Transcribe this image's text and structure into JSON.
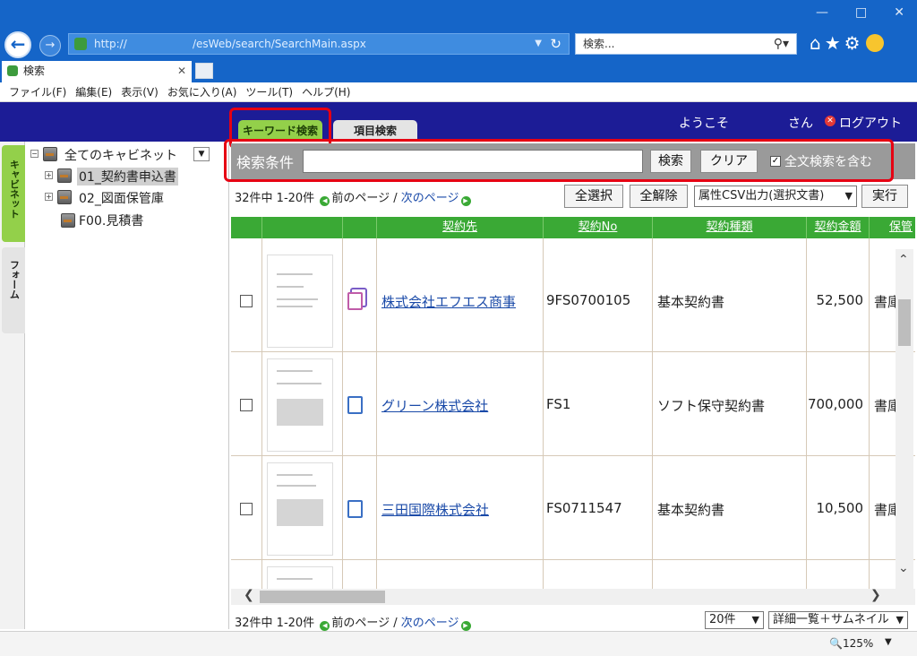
{
  "browser": {
    "url_prefix": "http://",
    "url_path": "/esWeb/search/SearchMain.aspx",
    "search_placeholder": "検索...",
    "tab_title": "検索",
    "menu": [
      "ファイル(F)",
      "編集(E)",
      "表示(V)",
      "お気に入り(A)",
      "ツール(T)",
      "ヘルプ(H)"
    ],
    "zoom": "125%"
  },
  "header": {
    "tab_keyword": "キーワード検索",
    "tab_item": "項目検索",
    "welcome": "ようこそ",
    "san": "さん",
    "logout": "ログアウト"
  },
  "sidebar": {
    "vtab_cabinet": "キャビネット",
    "vtab_form": "フォーム",
    "tree": {
      "root": "全てのキャビネット",
      "items": [
        "01_契約書申込書",
        "02_図面保管庫",
        "F00.見積書"
      ]
    }
  },
  "search": {
    "label": "検索条件",
    "input_value": "",
    "search_button": "検索",
    "clear_button": "クリア",
    "fulltext_checked": true,
    "fulltext_label": "全文検索を含む"
  },
  "paging": {
    "summary": "32件中 1-20件",
    "prev": "前のページ",
    "separator": "/",
    "next": "次のページ",
    "select_all": "全選択",
    "deselect_all": "全解除",
    "csv_option": "属性CSV出力(選択文書)",
    "run": "実行"
  },
  "table": {
    "columns": [
      "契約先",
      "契約No",
      "契約種類",
      "契約金額",
      "保管"
    ],
    "rows": [
      {
        "partner": "株式会社エフエス商事",
        "contract_no": "9FS0700105",
        "type": "基本契約書",
        "amount": "52,500",
        "storage": "書庫",
        "icon": "multi-document-icon"
      },
      {
        "partner": "グリーン株式会社",
        "contract_no": "FS1",
        "type": "ソフト保守契約書",
        "amount": "700,000",
        "storage": "書庫",
        "icon": "document-icon"
      },
      {
        "partner": "三田国際株式会社",
        "contract_no": "FS0711547",
        "type": "基本契約書",
        "amount": "10,500",
        "storage": "書庫",
        "icon": "document-icon"
      }
    ]
  },
  "bottom": {
    "page_size": "20件",
    "view_mode": "詳細一覧＋サムネイル"
  },
  "colors": {
    "header_bg": "#1c1c96",
    "active_tab": "#93d04a",
    "grid_header": "#3aa935",
    "highlight": "#e60012",
    "browser_blue": "#1565c8"
  }
}
